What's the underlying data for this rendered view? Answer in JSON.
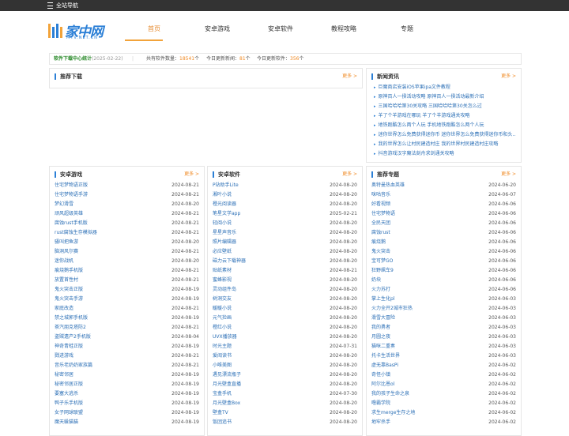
{
  "topbar": {
    "nav_label": "全站导航"
  },
  "logo": {
    "name": "家中网",
    "sub": "MTV.NET.CN"
  },
  "nav": [
    "首页",
    "安卓游戏",
    "安卓软件",
    "教程攻略",
    "专题"
  ],
  "stats": {
    "title": "软件下载中心统计",
    "date": "(2025-02-22)",
    "total_label": "共有软件数量：",
    "total_value": "18541",
    "total_unit": "个",
    "news_label": "今日更新新闻：",
    "news_value": "81",
    "news_unit": "个",
    "soft_label": "今日更新软件：",
    "soft_value": "356",
    "soft_unit": "个"
  },
  "recommend": {
    "title": "推荐下载",
    "more": "更多 >"
  },
  "news": {
    "title": "新闻资讯",
    "more": "更多 >",
    "items": [
      "巨魔商店安装iOS苹果ipa文件教程",
      "原神百人一揆活动攻略 原神百人一揆活动最新介绍",
      "三国哈哈哈第30关攻略 三国哈哈哈第30关怎么过",
      "羊了个羊游戏在哪玩 羊了个羊游戏通关攻略",
      "地铁跑酷怎么两个人玩 手机地铁跑酷怎么两个人玩",
      "迷你世界怎么免费获得迷你币 迷你世界怎么免费获得迷你币和头…",
      "我的世界怎么让村民建造村庄 我的世界村民建造村庄攻略",
      "抖音游戏汉字魔法刻舟求剑通关攻略"
    ]
  },
  "games": {
    "title": "安卓游戏",
    "more": "更多 >",
    "items": [
      {
        "t": "住宅梦物语正版",
        "d": "2024-08-21"
      },
      {
        "t": "住宅梦物语手游",
        "d": "2024-08-21"
      },
      {
        "t": "梦幻滑雪",
        "d": "2024-08-20"
      },
      {
        "t": "顽风超级英雄",
        "d": "2024-08-21"
      },
      {
        "t": "腐蚀rust手机版",
        "d": "2024-08-21"
      },
      {
        "t": "rust腐蚀生存模拟器",
        "d": "2024-08-21"
      },
      {
        "t": "骚叫把鱼游",
        "d": "2024-08-20"
      },
      {
        "t": "脑洞风尔赛",
        "d": "2024-08-21"
      },
      {
        "t": "迷你战机",
        "d": "2024-08-20"
      },
      {
        "t": "痕烧鹅手机版",
        "d": "2024-08-21"
      },
      {
        "t": "放置首性村",
        "d": "2024-08-21"
      },
      {
        "t": "鬼火突击正版",
        "d": "2024-08-19"
      },
      {
        "t": "鬼火突击手游",
        "d": "2024-08-19"
      },
      {
        "t": "家庭改造",
        "d": "2024-08-21"
      },
      {
        "t": "禁之城郭手机版",
        "d": "2024-08-19"
      },
      {
        "t": "茶汽朋克塔防2",
        "d": "2024-08-21"
      },
      {
        "t": "盗贼遗产2手机版",
        "d": "2024-08-04"
      },
      {
        "t": "神奇青蛙正版",
        "d": "2024-08-19"
      },
      {
        "t": "戮进游戏",
        "d": "2024-08-21"
      },
      {
        "t": "音乐老奶奶家族篇",
        "d": "2024-08-21"
      },
      {
        "t": "秘密邻居",
        "d": "2024-08-19"
      },
      {
        "t": "秘密邻居正版",
        "d": "2024-08-19"
      },
      {
        "t": "要塞大逃杀",
        "d": "2024-08-19"
      },
      {
        "t": "鸭子乐手机版",
        "d": "2024-08-19"
      },
      {
        "t": "女子网球联盟",
        "d": "2024-08-19"
      },
      {
        "t": "魔天躲猫猫",
        "d": "2024-08-19"
      }
    ]
  },
  "apps": {
    "title": "安卓软件",
    "more": "更多 >",
    "items": [
      {
        "t": "P站助手Lite",
        "d": "2024-08-20"
      },
      {
        "t": "湘叶小说",
        "d": "2024-08-20"
      },
      {
        "t": "橙光阅读器",
        "d": "2024-08-20"
      },
      {
        "t": "笔星文学app",
        "d": "2025-02-21"
      },
      {
        "t": "轻阅小说",
        "d": "2024-08-20"
      },
      {
        "t": "星星声音乐",
        "d": "2024-08-20"
      },
      {
        "t": "照片编辑器",
        "d": "2024-08-20"
      },
      {
        "t": "必应壁纸",
        "d": "2024-08-20"
      },
      {
        "t": "磁力云下载神器",
        "d": "2024-08-20"
      },
      {
        "t": "贴纸素材",
        "d": "2024-08-21"
      },
      {
        "t": "蜜蜂影视",
        "d": "2024-08-20"
      },
      {
        "t": "灵动组件岛",
        "d": "2024-08-20"
      },
      {
        "t": "树洞交友",
        "d": "2024-08-20"
      },
      {
        "t": "暖暖小说",
        "d": "2024-08-20"
      },
      {
        "t": "元气捡画",
        "d": "2024-08-20"
      },
      {
        "t": "橙红小说",
        "d": "2024-08-20"
      },
      {
        "t": "UVX播放器",
        "d": "2024-08-20"
      },
      {
        "t": "时光主题",
        "d": "2024-07-31"
      },
      {
        "t": "爱阅读书",
        "d": "2024-08-20"
      },
      {
        "t": "小唯美图",
        "d": "2024-08-20"
      },
      {
        "t": "遇见漂流瓶子",
        "d": "2024-08-20"
      },
      {
        "t": "月光壁盒直播",
        "d": "2024-08-20"
      },
      {
        "t": "宝盒手机",
        "d": "2024-07-30"
      },
      {
        "t": "月光壁盒Box",
        "d": "2024-08-20"
      },
      {
        "t": "壁盒TV",
        "d": "2024-08-20"
      },
      {
        "t": "饭团追书",
        "d": "2024-08-20"
      }
    ]
  },
  "topics": {
    "title": "推荐专题",
    "more": "更多 >",
    "items": [
      {
        "t": "奥特曼热血英雄",
        "d": "2024-06-20"
      },
      {
        "t": "咪咕音乐",
        "d": "2024-06-07"
      },
      {
        "t": "好看视频",
        "d": "2024-06-06"
      },
      {
        "t": "住宅梦物语",
        "d": "2024-06-06"
      },
      {
        "t": "全民天团",
        "d": "2024-06-06"
      },
      {
        "t": "腐蚀rust",
        "d": "2024-06-06"
      },
      {
        "t": "痕烧鹅",
        "d": "2024-06-06"
      },
      {
        "t": "鬼火突击",
        "d": "2024-06-06"
      },
      {
        "t": "宝可梦GO",
        "d": "2024-06-06"
      },
      {
        "t": "狂野飙车9",
        "d": "2024-06-06"
      },
      {
        "t": "奶块",
        "d": "2024-06-06"
      },
      {
        "t": "火力苏打",
        "d": "2024-06-06"
      },
      {
        "t": "掌上生化pl",
        "d": "2024-06-03"
      },
      {
        "t": "火力全开2城市狂热",
        "d": "2024-06-03"
      },
      {
        "t": "滑雪大冒险",
        "d": "2024-06-03"
      },
      {
        "t": "我的勇者",
        "d": "2024-06-03"
      },
      {
        "t": "月圆之夜",
        "d": "2024-06-03"
      },
      {
        "t": "猫咪二重奏",
        "d": "2024-06-03"
      },
      {
        "t": "托卡生活世界",
        "d": "2024-06-03"
      },
      {
        "t": "虚无靠BasPi",
        "d": "2024-06-02"
      },
      {
        "t": "奇怪小镇",
        "d": "2024-06-02"
      },
      {
        "t": "阿尔比恩ol",
        "d": "2024-06-02"
      },
      {
        "t": "我的孩子生命之泉",
        "d": "2024-06-02"
      },
      {
        "t": "噜霸学院",
        "d": "2024-06-02"
      },
      {
        "t": "求生merge生存之地",
        "d": "2024-06-02"
      },
      {
        "t": "地牢杀手",
        "d": "2024-06-02"
      }
    ]
  }
}
